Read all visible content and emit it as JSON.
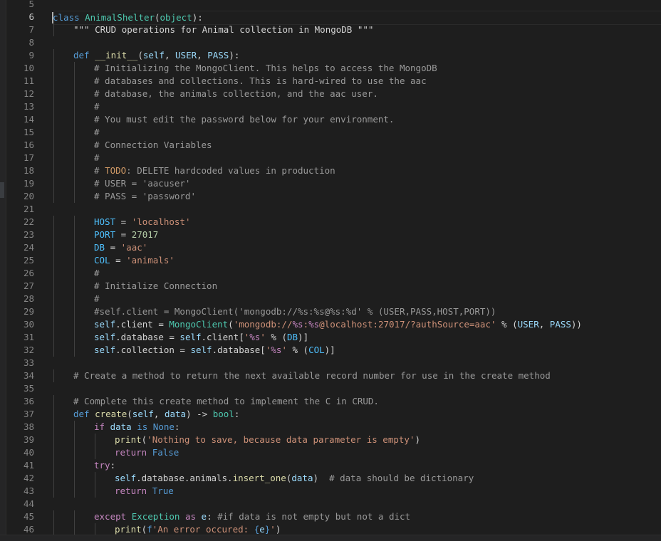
{
  "editor": {
    "language": "python",
    "active_line": 6,
    "colors": {
      "background": "#1e1e1e",
      "default": "#d4d4d4",
      "keyword": "#569cd6",
      "control": "#c586c0",
      "function": "#dcdcaa",
      "class": "#4ec9b0",
      "string": "#ce9178",
      "comment": "#9a9a9a",
      "number": "#b5cea8",
      "variable": "#9cdcfe",
      "constant": "#4fc1ff",
      "todo": "#d19a66"
    },
    "lines": [
      {
        "n": "5",
        "indent": 0,
        "tokens": []
      },
      {
        "n": "6",
        "indent": 0,
        "tokens": [
          {
            "t": "class ",
            "c": "keyword"
          },
          {
            "t": "AnimalShelter",
            "c": "class"
          },
          {
            "t": "("
          },
          {
            "t": "object",
            "c": "class"
          },
          {
            "t": "):"
          }
        ]
      },
      {
        "n": "7",
        "indent": 1,
        "tokens": [
          {
            "t": "\"\"\" CRUD operations for Animal collection in MongoDB \"\"\""
          }
        ]
      },
      {
        "n": "8",
        "indent": 0,
        "tokens": []
      },
      {
        "n": "9",
        "indent": 1,
        "tokens": [
          {
            "t": "def ",
            "c": "keyword"
          },
          {
            "t": "__init__",
            "c": "function"
          },
          {
            "t": "("
          },
          {
            "t": "self",
            "c": "variable"
          },
          {
            "t": ", "
          },
          {
            "t": "USER",
            "c": "variable"
          },
          {
            "t": ", "
          },
          {
            "t": "PASS",
            "c": "variable"
          },
          {
            "t": "):"
          }
        ]
      },
      {
        "n": "10",
        "indent": 2,
        "tokens": [
          {
            "t": "# Initializing the MongoClient. This helps to access the MongoDB",
            "c": "comment"
          }
        ]
      },
      {
        "n": "11",
        "indent": 2,
        "tokens": [
          {
            "t": "# databases and collections. This is hard-wired to use the aac",
            "c": "comment"
          }
        ]
      },
      {
        "n": "12",
        "indent": 2,
        "tokens": [
          {
            "t": "# database, the animals collection, and the aac user.",
            "c": "comment"
          }
        ]
      },
      {
        "n": "13",
        "indent": 2,
        "tokens": [
          {
            "t": "#",
            "c": "comment"
          }
        ]
      },
      {
        "n": "14",
        "indent": 2,
        "tokens": [
          {
            "t": "# You must edit the password below for your environment.",
            "c": "comment"
          }
        ]
      },
      {
        "n": "15",
        "indent": 2,
        "tokens": [
          {
            "t": "#",
            "c": "comment"
          }
        ]
      },
      {
        "n": "16",
        "indent": 2,
        "tokens": [
          {
            "t": "# Connection Variables",
            "c": "comment"
          }
        ]
      },
      {
        "n": "17",
        "indent": 2,
        "tokens": [
          {
            "t": "#",
            "c": "comment"
          }
        ]
      },
      {
        "n": "18",
        "indent": 2,
        "tokens": [
          {
            "t": "# ",
            "c": "comment"
          },
          {
            "t": "TODO",
            "c": "todo"
          },
          {
            "t": ": DELETE hardcoded values in production",
            "c": "comment"
          }
        ]
      },
      {
        "n": "19",
        "indent": 2,
        "tokens": [
          {
            "t": "# USER = 'aacuser'",
            "c": "comment"
          }
        ]
      },
      {
        "n": "20",
        "indent": 2,
        "tokens": [
          {
            "t": "# PASS = 'password'",
            "c": "comment"
          }
        ]
      },
      {
        "n": "21",
        "indent": 0,
        "tokens": []
      },
      {
        "n": "22",
        "indent": 2,
        "tokens": [
          {
            "t": "HOST",
            "c": "constant"
          },
          {
            "t": " = "
          },
          {
            "t": "'localhost'",
            "c": "string"
          }
        ]
      },
      {
        "n": "23",
        "indent": 2,
        "tokens": [
          {
            "t": "PORT",
            "c": "constant"
          },
          {
            "t": " = "
          },
          {
            "t": "27017",
            "c": "number"
          }
        ]
      },
      {
        "n": "24",
        "indent": 2,
        "tokens": [
          {
            "t": "DB",
            "c": "constant"
          },
          {
            "t": " = "
          },
          {
            "t": "'aac'",
            "c": "string"
          }
        ]
      },
      {
        "n": "25",
        "indent": 2,
        "tokens": [
          {
            "t": "COL",
            "c": "constant"
          },
          {
            "t": " = "
          },
          {
            "t": "'animals'",
            "c": "string"
          }
        ]
      },
      {
        "n": "26",
        "indent": 2,
        "tokens": [
          {
            "t": "#",
            "c": "comment"
          }
        ]
      },
      {
        "n": "27",
        "indent": 2,
        "tokens": [
          {
            "t": "# Initialize Connection",
            "c": "comment"
          }
        ]
      },
      {
        "n": "28",
        "indent": 2,
        "tokens": [
          {
            "t": "#",
            "c": "comment"
          }
        ]
      },
      {
        "n": "29",
        "indent": 2,
        "tokens": [
          {
            "t": "#self.client = MongoClient('mongodb://%s:%s@%s:%d' % (USER,PASS,HOST,PORT))",
            "c": "comment"
          }
        ]
      },
      {
        "n": "30",
        "indent": 2,
        "tokens": [
          {
            "t": "self",
            "c": "variable"
          },
          {
            "t": ".client = "
          },
          {
            "t": "MongoClient",
            "c": "class"
          },
          {
            "t": "("
          },
          {
            "t": "'mongodb://",
            "c": "string"
          },
          {
            "t": "%s",
            "c": "control"
          },
          {
            "t": ":",
            "c": "string"
          },
          {
            "t": "%s",
            "c": "control"
          },
          {
            "t": "@localhost:27017/?authSource=aac'",
            "c": "string"
          },
          {
            "t": " % ("
          },
          {
            "t": "USER",
            "c": "variable"
          },
          {
            "t": ", "
          },
          {
            "t": "PASS",
            "c": "variable"
          },
          {
            "t": "))"
          }
        ]
      },
      {
        "n": "31",
        "indent": 2,
        "tokens": [
          {
            "t": "self",
            "c": "variable"
          },
          {
            "t": ".database = "
          },
          {
            "t": "self",
            "c": "variable"
          },
          {
            "t": ".client["
          },
          {
            "t": "'",
            "c": "string"
          },
          {
            "t": "%s",
            "c": "control"
          },
          {
            "t": "'",
            "c": "string"
          },
          {
            "t": " % ("
          },
          {
            "t": "DB",
            "c": "constant"
          },
          {
            "t": ")]"
          }
        ]
      },
      {
        "n": "32",
        "indent": 2,
        "tokens": [
          {
            "t": "self",
            "c": "variable"
          },
          {
            "t": ".collection = "
          },
          {
            "t": "self",
            "c": "variable"
          },
          {
            "t": ".database["
          },
          {
            "t": "'",
            "c": "string"
          },
          {
            "t": "%s",
            "c": "control"
          },
          {
            "t": "'",
            "c": "string"
          },
          {
            "t": " % ("
          },
          {
            "t": "COL",
            "c": "constant"
          },
          {
            "t": ")]"
          }
        ]
      },
      {
        "n": "33",
        "indent": 0,
        "tokens": []
      },
      {
        "n": "34",
        "indent": 1,
        "tokens": [
          {
            "t": "# Create a method to return the next available record number for use in the create method",
            "c": "comment"
          }
        ]
      },
      {
        "n": "35",
        "indent": 0,
        "tokens": []
      },
      {
        "n": "36",
        "indent": 1,
        "tokens": [
          {
            "t": "# Complete this create method to implement the C in CRUD.",
            "c": "comment"
          }
        ]
      },
      {
        "n": "37",
        "indent": 1,
        "tokens": [
          {
            "t": "def ",
            "c": "keyword"
          },
          {
            "t": "create",
            "c": "function"
          },
          {
            "t": "("
          },
          {
            "t": "self",
            "c": "variable"
          },
          {
            "t": ", "
          },
          {
            "t": "data",
            "c": "variable"
          },
          {
            "t": ") -> "
          },
          {
            "t": "bool",
            "c": "class"
          },
          {
            "t": ":"
          }
        ]
      },
      {
        "n": "38",
        "indent": 2,
        "tokens": [
          {
            "t": "if ",
            "c": "control"
          },
          {
            "t": "data",
            "c": "variable"
          },
          {
            "t": " is ",
            "c": "keyword"
          },
          {
            "t": "None",
            "c": "keyword"
          },
          {
            "t": ":"
          }
        ]
      },
      {
        "n": "39",
        "indent": 3,
        "tokens": [
          {
            "t": "print",
            "c": "function"
          },
          {
            "t": "("
          },
          {
            "t": "'Nothing to save, because data parameter is empty'",
            "c": "string"
          },
          {
            "t": ")"
          }
        ]
      },
      {
        "n": "40",
        "indent": 3,
        "tokens": [
          {
            "t": "return ",
            "c": "control"
          },
          {
            "t": "False",
            "c": "keyword"
          }
        ]
      },
      {
        "n": "41",
        "indent": 2,
        "tokens": [
          {
            "t": "try",
            "c": "control"
          },
          {
            "t": ":"
          }
        ]
      },
      {
        "n": "42",
        "indent": 3,
        "tokens": [
          {
            "t": "self",
            "c": "variable"
          },
          {
            "t": ".database.animals."
          },
          {
            "t": "insert_one",
            "c": "function"
          },
          {
            "t": "("
          },
          {
            "t": "data",
            "c": "variable"
          },
          {
            "t": ")  "
          },
          {
            "t": "# data should be dictionary",
            "c": "comment"
          }
        ]
      },
      {
        "n": "43",
        "indent": 3,
        "tokens": [
          {
            "t": "return ",
            "c": "control"
          },
          {
            "t": "True",
            "c": "keyword"
          }
        ]
      },
      {
        "n": "44",
        "indent": 0,
        "tokens": []
      },
      {
        "n": "45",
        "indent": 2,
        "tokens": [
          {
            "t": "except ",
            "c": "control"
          },
          {
            "t": "Exception",
            "c": "class"
          },
          {
            "t": " as ",
            "c": "control"
          },
          {
            "t": "e",
            "c": "variable"
          },
          {
            "t": ": "
          },
          {
            "t": "#if data is not empty but not a dict",
            "c": "comment"
          }
        ]
      },
      {
        "n": "46",
        "indent": 3,
        "tokens": [
          {
            "t": "print",
            "c": "function"
          },
          {
            "t": "("
          },
          {
            "t": "f",
            "c": "keyword"
          },
          {
            "t": "'An error occured: ",
            "c": "string"
          },
          {
            "t": "{",
            "c": "keyword"
          },
          {
            "t": "e",
            "c": "variable"
          },
          {
            "t": "}",
            "c": "keyword"
          },
          {
            "t": "'",
            "c": "string"
          },
          {
            "t": ")"
          }
        ]
      }
    ]
  }
}
